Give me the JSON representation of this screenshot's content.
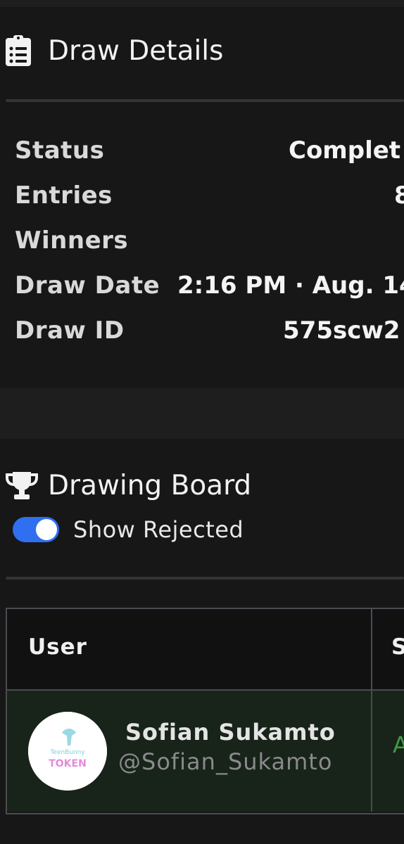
{
  "draw_details": {
    "title": "Draw Details",
    "icon": "clipboard-list-icon",
    "rows": [
      {
        "label": "Status",
        "value": "Complet"
      },
      {
        "label": "Entries",
        "value": "8"
      },
      {
        "label": "Winners",
        "value": ""
      },
      {
        "label": "Draw Date",
        "value": "2:16 PM · Aug. 14,"
      },
      {
        "label": "Draw ID",
        "value": "575scw2"
      }
    ]
  },
  "drawing_board": {
    "title": "Drawing Board",
    "icon": "trophy-icon",
    "toggle": {
      "label": "Show Rejected",
      "checked": true,
      "color": "#2f6ff0"
    },
    "table": {
      "columns": [
        "User",
        "S"
      ],
      "rows": [
        {
          "name": "Sofian Sukamto",
          "handle": "@Sofian_Sukamto",
          "status": "A",
          "avatar_text": "TOKEN",
          "avatar_small_text": "TeenBunny"
        }
      ]
    }
  },
  "colors": {
    "background": "#1e1e1f",
    "card": "#171718",
    "accent": "#2f6ff0",
    "status_green": "#3d9a45"
  }
}
